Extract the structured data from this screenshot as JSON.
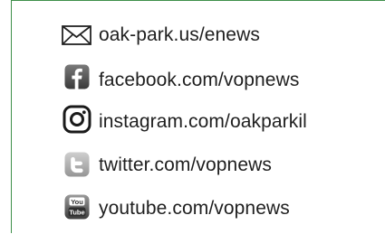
{
  "links": [
    {
      "icon": "envelope-icon",
      "text": "oak-park.us/enews"
    },
    {
      "icon": "facebook-icon",
      "text": "facebook.com/vopnews"
    },
    {
      "icon": "instagram-icon",
      "text": "instagram.com/oakparkil"
    },
    {
      "icon": "twitter-icon",
      "text": "twitter.com/vopnews"
    },
    {
      "icon": "youtube-icon",
      "text": "youtube.com/vopnews",
      "icon_text_top": "You",
      "icon_text_bottom": "Tube"
    }
  ],
  "colors": {
    "border": "#3f8f4a",
    "text": "#1f1f1f",
    "icon_dark": "#4a4a4a",
    "icon_light": "#a8a8a8"
  }
}
